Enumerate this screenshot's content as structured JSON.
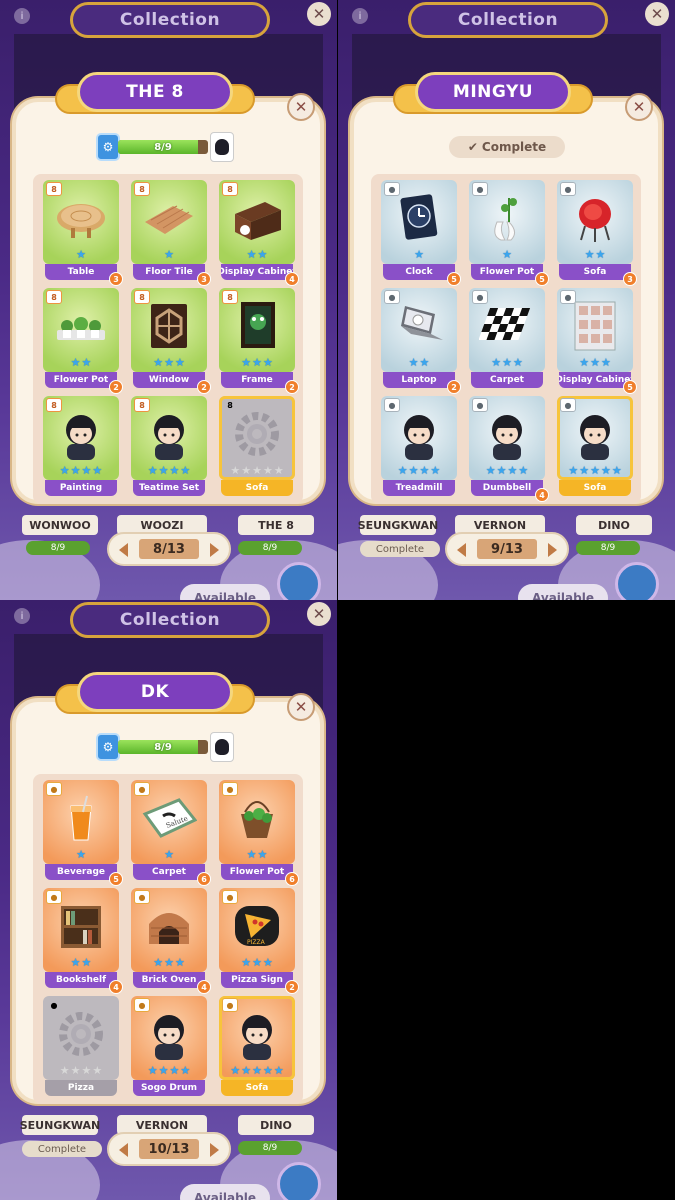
{
  "screen_title": "Collection",
  "close_glyph": "✕",
  "info_glyph": "i",
  "panels": [
    {
      "member_name": "THE 8",
      "progress_text": "8/9",
      "progress_fraction": 0.89,
      "pager": "8/13",
      "bg_under_labels": [
        "WONWOO",
        "WOOZI",
        "THE 8"
      ],
      "bg_bar_text": "8/9",
      "available_label": "Available",
      "items": [
        {
          "label": "Table",
          "stars": 1,
          "max": 1,
          "badge": "3",
          "flag": "8",
          "theme": "green",
          "pic": "table"
        },
        {
          "label": "Floor Tile",
          "stars": 1,
          "max": 1,
          "badge": "3",
          "flag": "8",
          "theme": "green",
          "pic": "tile"
        },
        {
          "label": "Display Cabinet",
          "stars": 2,
          "max": 2,
          "badge": "4",
          "flag": "8",
          "theme": "green",
          "pic": "cabinet"
        },
        {
          "label": "Flower Pot",
          "stars": 2,
          "max": 2,
          "badge": "2",
          "flag": "8",
          "theme": "green",
          "pic": "plants"
        },
        {
          "label": "Window",
          "stars": 3,
          "max": 3,
          "badge": "2",
          "flag": "8",
          "theme": "green",
          "pic": "window"
        },
        {
          "label": "Frame",
          "stars": 3,
          "max": 3,
          "badge": "2",
          "flag": "8",
          "theme": "green",
          "pic": "frame"
        },
        {
          "label": "Painting",
          "stars": 4,
          "max": 4,
          "badge": "",
          "flag": "8",
          "theme": "green",
          "pic": "person"
        },
        {
          "label": "Teatime Set",
          "stars": 4,
          "max": 4,
          "badge": "",
          "flag": "8",
          "theme": "green",
          "pic": "person"
        },
        {
          "label": "Sofa",
          "stars": 0,
          "max": 5,
          "badge": "",
          "flag": "8",
          "theme": "gray",
          "pic": "gear",
          "gold": true
        }
      ]
    },
    {
      "member_name": "MINGYU",
      "complete_label": "Complete",
      "complete_icon": "check-icon",
      "pager": "9/13",
      "bg_under_labels": [
        "SEUNGKWAN",
        "VERNON",
        "DINO"
      ],
      "bg_complete_text": "Complete",
      "bg_bar_text": "8/9",
      "available_label": "Available",
      "items": [
        {
          "label": "Clock",
          "stars": 1,
          "max": 1,
          "badge": "5",
          "flag": "",
          "theme": "blue",
          "pic": "clock"
        },
        {
          "label": "Flower Pot",
          "stars": 1,
          "max": 1,
          "badge": "5",
          "flag": "",
          "theme": "blue",
          "pic": "vase"
        },
        {
          "label": "Sofa",
          "stars": 2,
          "max": 2,
          "badge": "3",
          "flag": "",
          "theme": "blue",
          "pic": "chair"
        },
        {
          "label": "Laptop",
          "stars": 2,
          "max": 2,
          "badge": "2",
          "flag": "",
          "theme": "blue",
          "pic": "laptop"
        },
        {
          "label": "Carpet",
          "stars": 3,
          "max": 3,
          "badge": "",
          "flag": "",
          "theme": "blue",
          "pic": "checker"
        },
        {
          "label": "Display Cabinet",
          "stars": 3,
          "max": 3,
          "badge": "5",
          "flag": "",
          "theme": "blue",
          "pic": "shelf"
        },
        {
          "label": "Treadmill",
          "stars": 4,
          "max": 4,
          "badge": "",
          "flag": "",
          "theme": "blue",
          "pic": "person"
        },
        {
          "label": "Dumbbell",
          "stars": 4,
          "max": 4,
          "badge": "4",
          "flag": "",
          "theme": "blue",
          "pic": "person"
        },
        {
          "label": "Sofa",
          "stars": 5,
          "max": 5,
          "badge": "",
          "flag": "",
          "theme": "blue",
          "pic": "person",
          "gold": true
        }
      ]
    },
    {
      "member_name": "DK",
      "progress_text": "8/9",
      "progress_fraction": 0.89,
      "pager": "10/13",
      "bg_under_labels": [
        "SEUNGKWAN",
        "VERNON",
        "DINO"
      ],
      "bg_complete_text": "Complete",
      "bg_bar_text": "8/9",
      "available_label": "Available",
      "items": [
        {
          "label": "Beverage",
          "stars": 1,
          "max": 1,
          "badge": "5",
          "flag": "",
          "theme": "orange",
          "pic": "drink"
        },
        {
          "label": "Carpet",
          "stars": 1,
          "max": 1,
          "badge": "6",
          "flag": "",
          "theme": "orange",
          "pic": "mat",
          "pic_text": "Salute"
        },
        {
          "label": "Flower Pot",
          "stars": 2,
          "max": 2,
          "badge": "6",
          "flag": "",
          "theme": "orange",
          "pic": "basket"
        },
        {
          "label": "Bookshelf",
          "stars": 2,
          "max": 2,
          "badge": "4",
          "flag": "",
          "theme": "orange",
          "pic": "bookshelf"
        },
        {
          "label": "Brick Oven",
          "stars": 3,
          "max": 3,
          "badge": "4",
          "flag": "",
          "theme": "orange",
          "pic": "oven"
        },
        {
          "label": "Pizza Sign",
          "stars": 3,
          "max": 3,
          "badge": "2",
          "flag": "",
          "theme": "orange",
          "pic": "pizza",
          "pic_text": "PIZZA"
        },
        {
          "label": "Pizza",
          "stars": 0,
          "max": 4,
          "badge": "",
          "flag": "",
          "theme": "gray",
          "pic": "gear"
        },
        {
          "label": "Sogo Drum",
          "stars": 4,
          "max": 4,
          "badge": "",
          "flag": "",
          "theme": "orange",
          "pic": "person"
        },
        {
          "label": "Sofa",
          "stars": 5,
          "max": 5,
          "badge": "",
          "flag": "",
          "theme": "orange",
          "pic": "person",
          "gold": true
        }
      ]
    }
  ]
}
